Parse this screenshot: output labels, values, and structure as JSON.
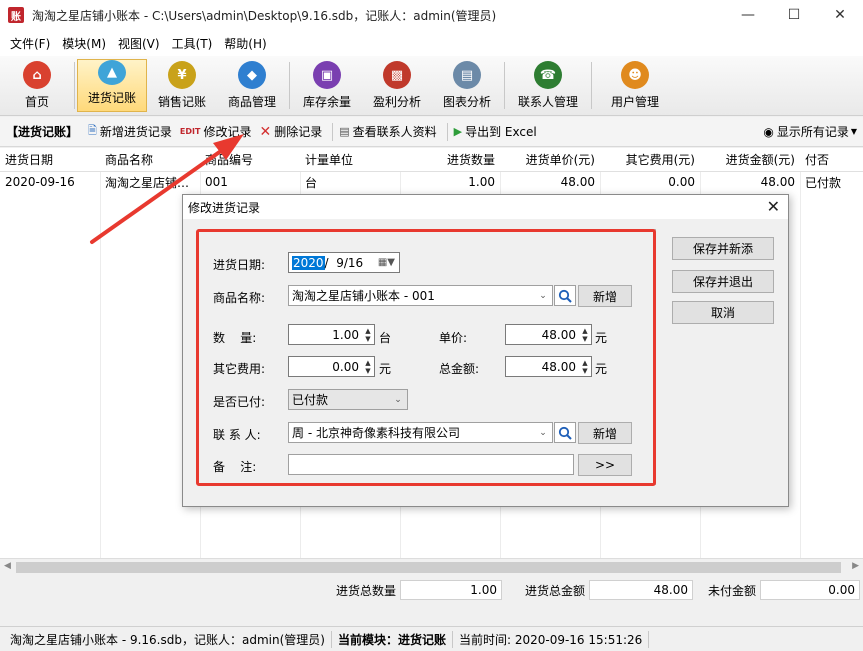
{
  "window": {
    "icon_text": "账",
    "title": "淘淘之星店铺小账本 - C:\\Users\\admin\\Desktop\\9.16.sdb，记账人：admin(管理员)"
  },
  "menu": [
    "文件(F)",
    "模块(M)",
    "视图(V)",
    "工具(T)",
    "帮助(H)"
  ],
  "toolbar": [
    {
      "label": "首页",
      "icon": "home-icon",
      "color": "#d9412f"
    },
    {
      "label": "进货记账",
      "icon": "purchase-icon",
      "color": "#3fa4d8"
    },
    {
      "label": "销售记账",
      "icon": "sales-icon",
      "color": "#c9a21a"
    },
    {
      "label": "商品管理",
      "icon": "goods-icon",
      "color": "#2f7fd0"
    },
    {
      "label": "库存余量",
      "icon": "stock-icon",
      "color": "#7a3fb0"
    },
    {
      "label": "盈利分析",
      "icon": "profit-icon",
      "color": "#c0392b"
    },
    {
      "label": "图表分析",
      "icon": "chart-icon",
      "color": "#6c8aa8"
    },
    {
      "label": "联系人管理",
      "icon": "contact-icon",
      "color": "#2e7d32"
    },
    {
      "label": "用户管理",
      "icon": "user-icon",
      "color": "#e08a1e"
    }
  ],
  "subbar": {
    "title": "【进货记账】",
    "add": "新增进货记录",
    "edit_prefix": "EDIT",
    "edit": "修改记录",
    "delete": "删除记录",
    "view_contact": "查看联系人资料",
    "export": "导出到 Excel",
    "show_all": "显示所有记录"
  },
  "grid": {
    "headers": [
      "进货日期",
      "商品名称",
      "商品编号",
      "计量单位",
      "进货数量",
      "进货单价(元)",
      "其它费用(元)",
      "进货金额(元)",
      "付否"
    ],
    "rows": [
      [
        "2020-09-16",
        "淘淘之星店铺…",
        "001",
        "台",
        "1.00",
        "48.00",
        "0.00",
        "48.00",
        "已付款"
      ]
    ]
  },
  "totals": {
    "qty_label": "进货总数量",
    "qty": "1.00",
    "amount_label": "进货总金额",
    "amount": "48.00",
    "unpaid_label": "未付金额",
    "unpaid": "0.00"
  },
  "status": {
    "app": "淘淘之星店铺小账本 - 9.16.sdb，记账人：admin(管理员)",
    "module_label": "当前模块：进货记账",
    "time": "当前时间: 2020-09-16 15:51:26"
  },
  "dialog": {
    "title": "修改进货记录",
    "date_label": "进货日期:",
    "date_year": "2020",
    "date_rest": "/  9/16",
    "goods_label": "商品名称:",
    "goods_value": "淘淘之星店铺小账本 - 001",
    "new_label": "新增",
    "qty_label": "数    量:",
    "qty_value": "1.00",
    "qty_unit": "台",
    "price_label": "单价:",
    "price_value": "48.00",
    "price_unit": "元",
    "other_label": "其它费用:",
    "other_value": "0.00",
    "other_unit": "元",
    "total_label": "总金额:",
    "total_value": "48.00",
    "total_unit": "元",
    "paid_label": "是否已付:",
    "paid_value": "已付款",
    "contact_label": "联 系 人:",
    "contact_value": "周 - 北京神奇像素科技有限公司",
    "remark_label": "备    注:",
    "remark_value": "",
    "more_label": ">>",
    "save_new": "保存并新添",
    "save_exit": "保存并退出",
    "cancel": "取消"
  },
  "colors": {
    "highlight": "#e8392f",
    "selection": "#0078d7"
  }
}
